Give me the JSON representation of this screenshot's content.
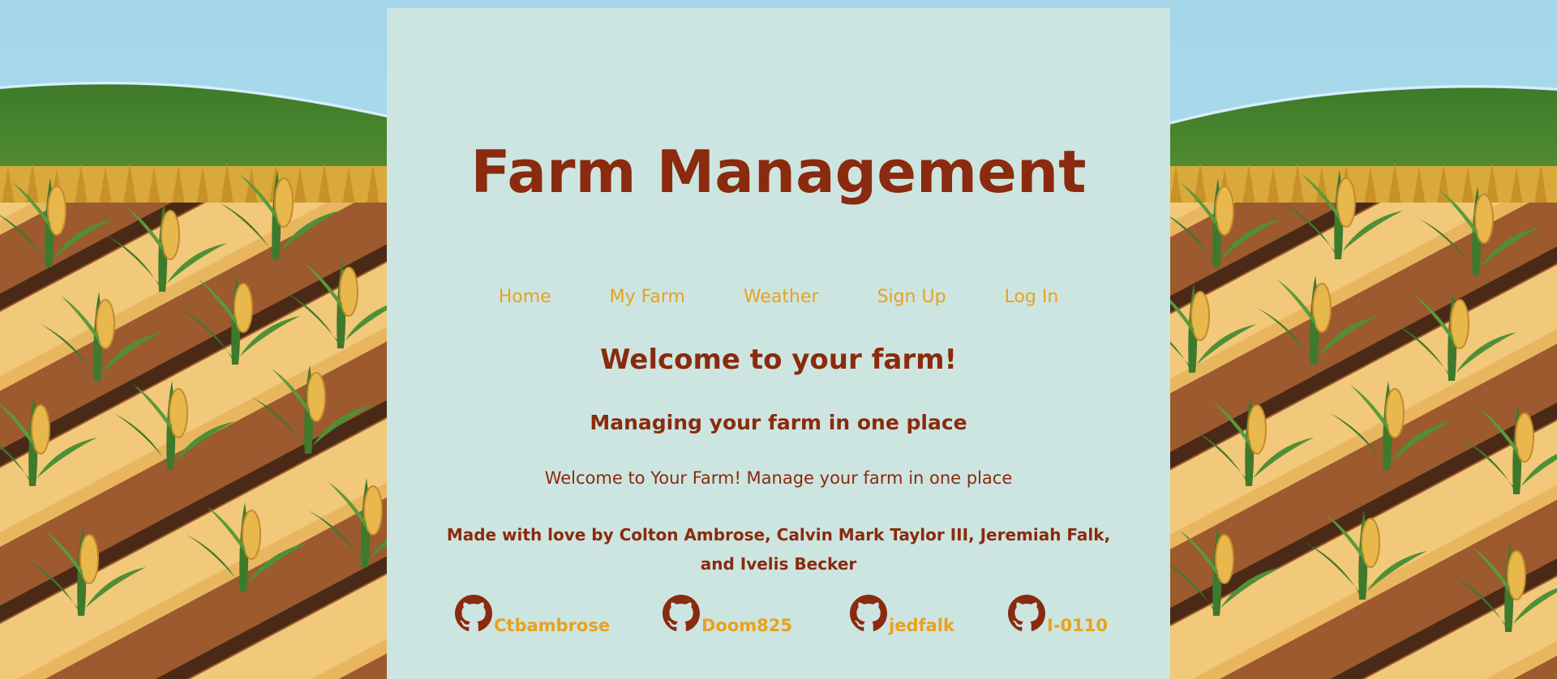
{
  "header": {
    "title": "Farm Management"
  },
  "nav": {
    "items": [
      {
        "label": "Home"
      },
      {
        "label": "My Farm"
      },
      {
        "label": "Weather"
      },
      {
        "label": "Sign Up"
      },
      {
        "label": "Log In"
      }
    ]
  },
  "main": {
    "welcome_heading": "Welcome to your farm!",
    "subheading": "Managing your farm in one place",
    "intro": "Welcome to Your Farm! Manage your farm in one place",
    "credits": "Made with love by Colton Ambrose, Calvin Mark Taylor III, Jeremiah Falk, and Ivelis Becker"
  },
  "github": {
    "icon": "github-icon",
    "users": [
      {
        "label": "Ctbambrose"
      },
      {
        "label": "Doom825"
      },
      {
        "label": "jedfalk"
      },
      {
        "label": "I-0110"
      }
    ]
  },
  "colors": {
    "panel": "#cde5e0",
    "heading": "#8a2a0e",
    "link": "#e8a21c",
    "sky": "#a8d8ea",
    "hill": "#4f8a30"
  }
}
